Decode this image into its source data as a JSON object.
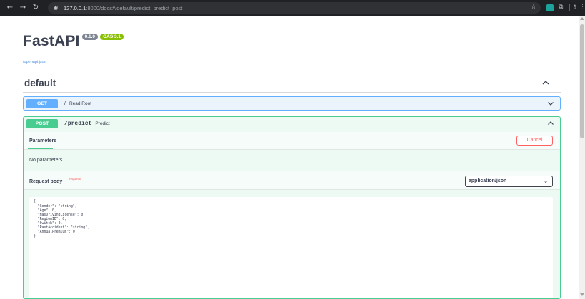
{
  "browser": {
    "url_host": "127.0.0.1",
    "url_rest": ":8000/docs#/default/predict_predict_post"
  },
  "header": {
    "title": "FastAPI",
    "version_badge": "0.1.0",
    "oas_badge": "OAS 3.1",
    "openapi_link": "/openapi.json"
  },
  "section": {
    "title": "default"
  },
  "operations": [
    {
      "method": "GET",
      "path": "/",
      "summary": "Read Root"
    },
    {
      "method": "POST",
      "path": "/predict",
      "summary": "Predict"
    }
  ],
  "post_panel": {
    "parameters_tab": "Parameters",
    "cancel_label": "Cancel",
    "no_params_text": "No parameters",
    "request_body_label": "Request body",
    "required_label": "required",
    "content_type": "application/json",
    "body_lines": [
      "{",
      "  \"Gender\": \"string\",",
      "  \"Age\": 0,",
      "  \"HasDrivingLicense\": 0,",
      "  \"RegionID\": 0,",
      "  \"Switch\": 0,",
      "  \"PastAccident\": \"string\",",
      "  \"AnnualPremium\": 0",
      "}"
    ]
  },
  "colors": {
    "get": "#61affe",
    "post": "#49cc90",
    "cancel": "#ff6060",
    "version_badge": "#7d8492",
    "oas_badge": "#89bf04"
  }
}
